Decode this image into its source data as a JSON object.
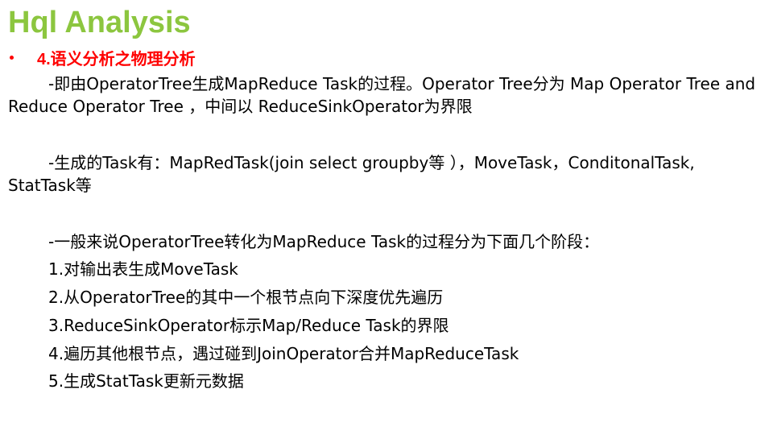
{
  "slide": {
    "title": "Hql Analysis",
    "section_heading": "4.语义分析之物理分析",
    "paragraphs": [
      "-即由OperatorTree生成MapReduce  Task的过程。Operator Tree分为 Map Operator Tree and Reduce Operator Tree  ，中间以 ReduceSinkOperator为界限",
      "-生成的Task有：MapRedTask(join   select  groupby等 ），MoveTask，ConditonalTask, StatTask等",
      "-一般来说OperatorTree转化为MapReduce Task的过程分为下面几个阶段："
    ],
    "steps": [
      "1.对输出表生成MoveTask",
      "2.从OperatorTree的其中一个根节点向下深度优先遍历",
      "3.ReduceSinkOperator标示Map/Reduce Task的界限",
      "4.遍历其他根节点，遇过碰到JoinOperator合并MapReduceTask",
      "5.生成StatTask更新元数据"
    ]
  },
  "colors": {
    "title": "#8cc63f",
    "section_heading": "#ff0000",
    "bullet": "#ff0000",
    "body_text": "#000000",
    "background": "#ffffff"
  },
  "icons": {
    "bullet": "bullet-dot-icon"
  }
}
